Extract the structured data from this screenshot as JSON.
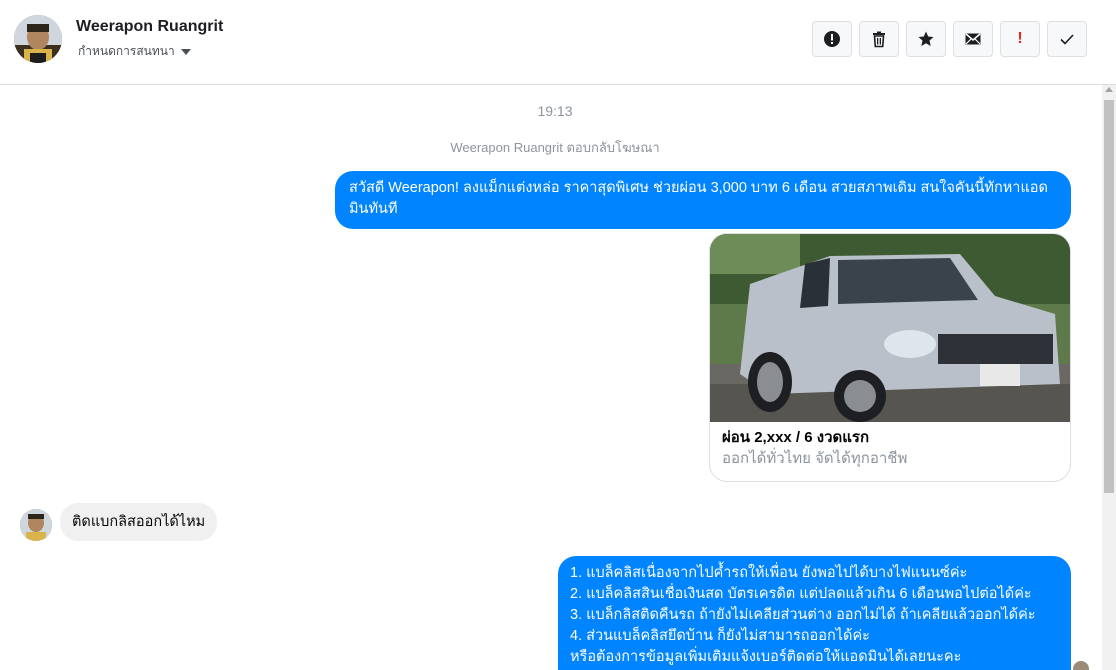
{
  "header": {
    "name": "Weerapon Ruangrit",
    "subtitle": "กำหนดการสนทนา"
  },
  "toolbar": {
    "icons": [
      "alert-icon",
      "trash-icon",
      "star-icon",
      "mail-icon",
      "exclamation-icon",
      "check-icon"
    ],
    "exclamation_text": "!"
  },
  "thread": {
    "timestamp": "19:13",
    "notice": "Weerapon Ruangrit ตอบกลับโฆษณา",
    "msg1": "สวัสดี Weerapon! ลงแม็กแต่งหล่อ ราคาสุดพิเศษ ช่วยผ่อน 3,000 บาท 6 เดือน สวยสภาพเดิม สนใจคันนี้ทักหาแอดมินทันที",
    "card": {
      "title": "ผ่อน 2,xxx / 6 งวดแรก",
      "subtitle": "ออกได้ทั่วไทย จัดได้ทุกอาชีพ"
    },
    "reply": "ติดแบกลิสออกได้ไหม",
    "msg2": [
      "1. แบล็คลิสเนื่องจากไปค้ำรถให้เพื่อน ยังพอไปได้บางไฟแนนซ์ค่ะ",
      "2. แบล็คลิสสินเชื่อเงินสด บัตรเครดิต แต่ปลดแล้วเกิน 6 เดือนพอไปต่อได้ค่ะ",
      "3. แบล็กลิสติดคืนรถ ถ้ายังไม่เคลียส่วนต่าง ออกไม่ได้ ถ้าเคลียแล้วออกได้ค่ะ",
      "4. ส่วนแบล็คลิสยึดบ้าน ก็ยังไม่สามารถออกได้ค่ะ",
      "  หรือต้องการข้อมูลเพิ่มเติมแจ้งเบอร์ติดต่อให้แอดมินได้เลยนะคะ"
    ]
  },
  "colors": {
    "outgoing_bubble": "#0084ff",
    "incoming_bubble": "#f1f0f0",
    "alert_red": "#e02a20"
  }
}
